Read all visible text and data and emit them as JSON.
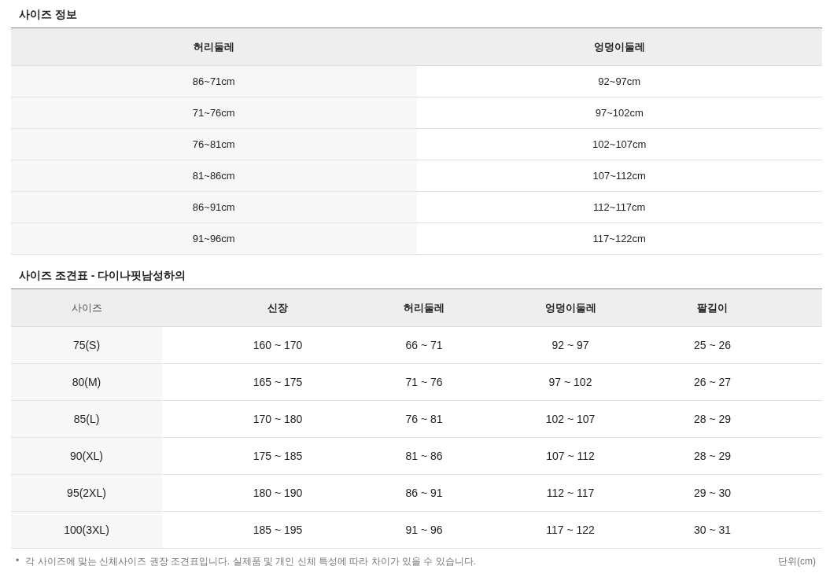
{
  "size_info": {
    "title": "사이즈 정보",
    "columns": [
      "허리둘레",
      "엉덩이둘레"
    ],
    "rows": [
      [
        "86~71cm",
        "92~97cm"
      ],
      [
        "71~76cm",
        "97~102cm"
      ],
      [
        "76~81cm",
        "102~107cm"
      ],
      [
        "81~86cm",
        "107~112cm"
      ],
      [
        "86~91cm",
        "112~117cm"
      ],
      [
        "91~96cm",
        "117~122cm"
      ]
    ]
  },
  "size_chart": {
    "title": "사이즈 조견표 - 다이나핏남성하의",
    "columns": [
      "사이즈",
      "신장",
      "허리둘레",
      "엉덩이둘레",
      "팔길이"
    ],
    "rows": [
      [
        "75(S)",
        "160 ~ 170",
        "66 ~ 71",
        "92 ~ 97",
        "25 ~ 26"
      ],
      [
        "80(M)",
        "165 ~ 175",
        "71 ~ 76",
        "97 ~ 102",
        "26 ~ 27"
      ],
      [
        "85(L)",
        "170 ~ 180",
        "76 ~ 81",
        "102 ~ 107",
        "28 ~ 29"
      ],
      [
        "90(XL)",
        "175 ~ 185",
        "81 ~ 86",
        "107 ~ 112",
        "28 ~ 29"
      ],
      [
        "95(2XL)",
        "180 ~ 190",
        "86 ~ 91",
        "112 ~ 117",
        "29 ~ 30"
      ],
      [
        "100(3XL)",
        "185 ~ 195",
        "91 ~ 96",
        "117 ~ 122",
        "30 ~ 31"
      ]
    ]
  },
  "footer": {
    "bullet": "•",
    "note": "각 사이즈에 맞는 신체사이즈 권장 조견표입니다. 실제품 및 개인 신체 특성에 따라 차이가 있을 수 있습니다.",
    "unit": "단위(cm)"
  }
}
